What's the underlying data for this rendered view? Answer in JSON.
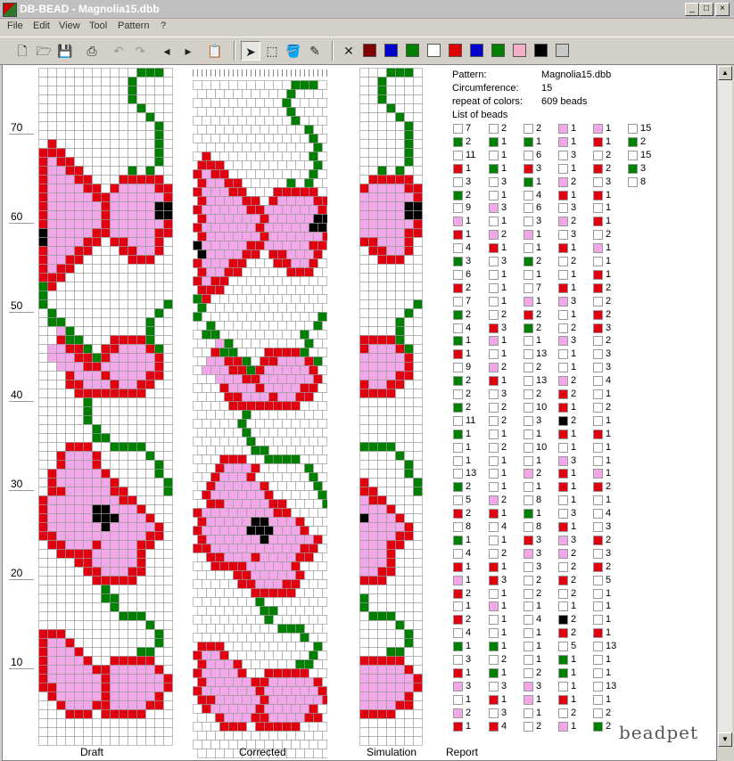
{
  "window": {
    "title": "DB-BEAD - Magnolia15.dbb"
  },
  "menu": [
    "File",
    "Edit",
    "View",
    "Tool",
    "Pattern",
    "?"
  ],
  "toolbar": {
    "swatches": [
      "#800000",
      "#0000cc",
      "#008000",
      "#ffffff",
      "#e00000",
      "#0000cc",
      "#008000",
      "#f4b0c8",
      "#000000",
      "#c8c8c8"
    ]
  },
  "ruler": {
    "labels": [
      "70",
      "60",
      "50",
      "40",
      "30",
      "20",
      "10"
    ]
  },
  "panes": {
    "draft": "Draft",
    "corrected": "Corrected",
    "simulation": "Simulation",
    "report": "Report"
  },
  "report": {
    "pattern_label": "Pattern:",
    "pattern_value": "Magnolia15.dbb",
    "circumference_label": "Circumference:",
    "circumference_value": "15",
    "repeat_label": "repeat of colors:",
    "repeat_value": "609 beads",
    "list_label": "List of beads"
  },
  "palette": {
    "W": "#ffffff",
    "G": "#008000",
    "R": "#e00010",
    "P": "#f2a8e8",
    "K": "#000000"
  },
  "bead_columns": [
    [
      "W7",
      "G2",
      "W11",
      "R1",
      "W3",
      "G2",
      "W9",
      "P1",
      "R1",
      "W4",
      "G3",
      "W6",
      "R2",
      "W7",
      "G2",
      "W4",
      "G1",
      "R1",
      "W9",
      "G2",
      "W2",
      "G2",
      "W11",
      "G1",
      "W1",
      "W1",
      "W13",
      "G2",
      "W5",
      "R2",
      "W8",
      "G1",
      "W4",
      "R1",
      "P1",
      "R2",
      "W1",
      "R2",
      "W4",
      "G1",
      "W3",
      "R1",
      "P3",
      "W1",
      "P2",
      "R1"
    ],
    [
      "W2",
      "G1",
      "W1",
      "G1",
      "W3",
      "W1",
      "P3",
      "W1",
      "P2",
      "R1",
      "W3",
      "W1",
      "W1",
      "W1",
      "W2",
      "R3",
      "P1",
      "W1",
      "P2",
      "R1",
      "W3",
      "W2",
      "W2",
      "W1",
      "W2",
      "W1",
      "W1",
      "W1",
      "P2",
      "R1",
      "W4",
      "W1",
      "W2",
      "R1",
      "R3",
      "W1",
      "P1",
      "W1",
      "W1",
      "G1",
      "W2",
      "G1",
      "W3",
      "R1",
      "W3",
      "R4"
    ],
    [
      "W2",
      "G1",
      "W6",
      "R3",
      "G1",
      "W4",
      "W6",
      "W3",
      "P1",
      "W1",
      "G2",
      "W1",
      "W7",
      "P1",
      "R2",
      "G2",
      "W1",
      "W13",
      "W2",
      "W13",
      "W2",
      "W10",
      "W3",
      "W1",
      "W10",
      "W1",
      "P2",
      "W1",
      "W8",
      "G1",
      "W8",
      "R3",
      "P3",
      "W3",
      "W2",
      "W2",
      "W1",
      "W4",
      "W1",
      "W1",
      "W1",
      "W2",
      "P3",
      "P1",
      "W1",
      "W2"
    ],
    [
      "P1",
      "P1",
      "W3",
      "W1",
      "P2",
      "R1",
      "W3",
      "P2",
      "W3",
      "R1",
      "W2",
      "W1",
      "R1",
      "P3",
      "W1",
      "W2",
      "P3",
      "W1",
      "W1",
      "P2",
      "R2",
      "R1",
      "K2",
      "R1",
      "W1",
      "P3",
      "R1",
      "R1",
      "W1",
      "W3",
      "R1",
      "P3",
      "P2",
      "W2",
      "R2",
      "W2",
      "W1",
      "K2",
      "R2",
      "W5",
      "G1",
      "G1",
      "W1",
      "R1",
      "W2",
      "P1"
    ],
    [
      "P1",
      "R1",
      "W2",
      "R2",
      "W3",
      "R1",
      "W1",
      "R1",
      "W2",
      "P1",
      "W1",
      "R1",
      "R2",
      "W2",
      "R2",
      "R3",
      "W2",
      "W3",
      "W3",
      "W4",
      "W1",
      "W2",
      "W1",
      "R1",
      "W1",
      "W1",
      "P1",
      "R2",
      "W1",
      "W4",
      "W3",
      "R2",
      "W3",
      "R2",
      "W5",
      "W1",
      "W1",
      "W1",
      "R1",
      "W13",
      "W1",
      "W1",
      "W13",
      "W1",
      "W2",
      "G2"
    ],
    [
      "W15",
      "G2",
      "W15",
      "G3",
      "W8"
    ]
  ],
  "pattern_rows": [
    "WWWWWWWWWWWGGGW",
    "WWWWWWWWWWGWWWW",
    "WWWWWWWWWWGWWWW",
    "WWWWWWWWWWGWWWW",
    "WWWWWWWWWWWGWWW",
    "WWWWWWWWWWWWGWW",
    "WWWWWWWWWWWWWGW",
    "WWWWWWWWWWWWWGW",
    "WRWWWWWWWWWWWGW",
    "RRRWWWWWWWWWWGW",
    "RPRRWWWWWWWWWGW",
    "RPPRRWWWWWGWGWW",
    "RPPPRRWWWRRRRRW",
    "RPPPPRRWRPPPPRR",
    "RPPPPPRRPPPPPPR",
    "RPPPPPPRPPPPPKK",
    "RPPPPPPRPPPPPKK",
    "RPPPPPPRPPPPPPR",
    "KPPPPPRRPPPPPRR",
    "KPPPPRRWRRPPPRW",
    "RPPPRRWWWRRPPRW",
    "RPPRRWWWWWRRRWW",
    "RPRRWWWWWWWWWWW",
    "RRRWWWWWWWWWWWW",
    "GRWWWWWWWWWWWWW",
    "GWWWWWWWWWWWWWW",
    "GWWWWWWWWWWWWWG",
    "WGWWWWWWWWWWWGW",
    "WGGWWWWWWWWWGWW",
    "WWPGWWWWWWWWGWW",
    "WWRGGWWWRRRRGWW",
    "WPPRRGWRRPPPRGW",
    "WPPPRRGRPPPPPRW",
    "WWPPPRRPPPPPPRW",
    "WWWRPPPRPPPPRRW",
    "WWWRRPPPRPPRRWW",
    "WWWWRRRRRRRRWWW",
    "WWWWWGWWWWWWWWW",
    "WWWWWGWWWWWWWWW",
    "WWWWWGWWWWWWWWW",
    "WWWWWWGWWWWWWWW",
    "WWWWWWGGWWWWWWW",
    "WWWRRRWWGGGGWWW",
    "WWRPPPRWWWWWGWW",
    "WWRPPPRWWWWWWGW",
    "WRPPPPPRWWWWWGW",
    "WRPPPPPPRWWWWWG",
    "WRRPPPPPRRWWWWG",
    "RPPPPPPPPRRWWWW",
    "RPPPPPKKPPPRWWW",
    "RPPPPPKKKPPPRWW",
    "RPPPPPPKPPPPPRW",
    "RRPPPPPPPPPPRRW",
    "WRRPPPRPPPPRRWW",
    "WWRRRRPPPPPRWWW",
    "WWWWRRPPPPPRWWW",
    "WWWWWRRPPPRRWWW",
    "WWWWWWRRRRRWWWW",
    "WWWWWWWGWWWWWWW",
    "WWWWWWWGGWWWWWW",
    "WWWWWWWWGWWWWWW",
    "WWWWWWWWWGGGWWW",
    "WWWWWWWWWWWWGWW",
    "RRRWWWWWWWWWWGW",
    "RPPRWWWWWWWWWGW",
    "RPPPRWWWWWWGGWW",
    "RPPPPRWWRRRRRWW",
    "RPPPPPRRPPPPPRW",
    "RPPPPPPRPPPPPPR",
    "RRPPPPPRPPPPPPR",
    "WRPPPPPRPPPPPRW",
    "WWRPPPRRPPPPRRW",
    "WWWRRRWRRRRRWWW",
    "WWWWWWWWWWWWWWW",
    "WWWWWWWWWWWWWWW",
    "WWWWWWWWWWWWWWW"
  ]
}
